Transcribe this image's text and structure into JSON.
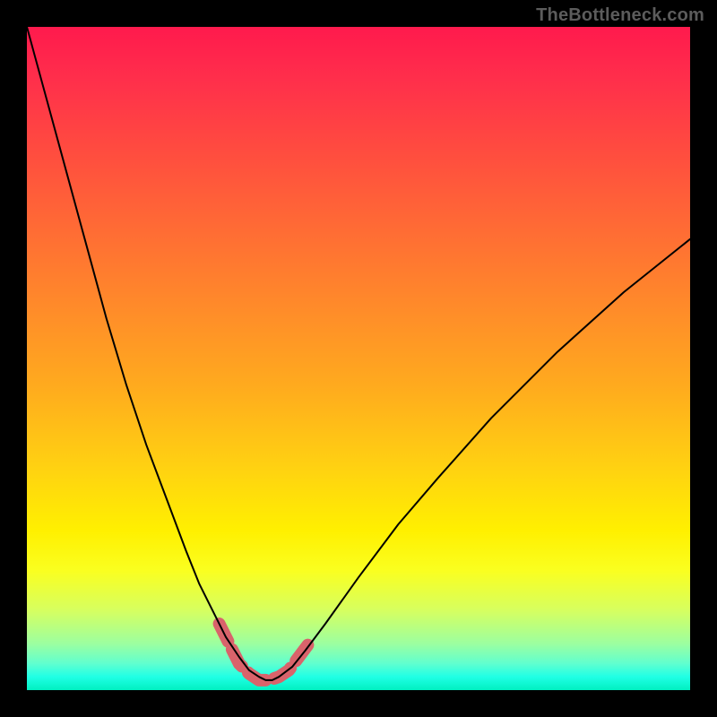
{
  "watermark": "TheBottleneck.com",
  "colors": {
    "background": "#000000",
    "curve": "#000000",
    "highlight": "#d9636b",
    "gradient_top": "#ff1a4d",
    "gradient_bottom": "#00f0c0"
  },
  "chart_data": {
    "type": "line",
    "title": "",
    "xlabel": "",
    "ylabel": "",
    "xlim": [
      0,
      100
    ],
    "ylim": [
      0,
      100
    ],
    "grid": false,
    "legend": false,
    "series": [
      {
        "name": "bottleneck-curve",
        "x": [
          0,
          3,
          6,
          9,
          12,
          15,
          18,
          21,
          24,
          26,
          28,
          30,
          32,
          33.5,
          35,
          36,
          37,
          38,
          40,
          42,
          45,
          50,
          56,
          62,
          70,
          80,
          90,
          100
        ],
        "y": [
          100,
          89,
          78,
          67,
          56,
          46,
          37,
          29,
          21,
          16,
          12,
          8,
          5,
          3,
          2,
          1.5,
          1.5,
          2,
          3.5,
          6,
          10,
          17,
          25,
          32,
          41,
          51,
          60,
          68
        ]
      }
    ],
    "annotations": [
      {
        "name": "valley-highlight",
        "style": "dashed",
        "color": "#d9636b",
        "x": [
          29,
          30.5,
          32,
          33.5,
          35,
          36.5,
          38,
          39.5,
          41,
          42.5
        ],
        "y": [
          10,
          7,
          4,
          2.5,
          1.5,
          1.5,
          2,
          3,
          5,
          7
        ]
      }
    ]
  }
}
